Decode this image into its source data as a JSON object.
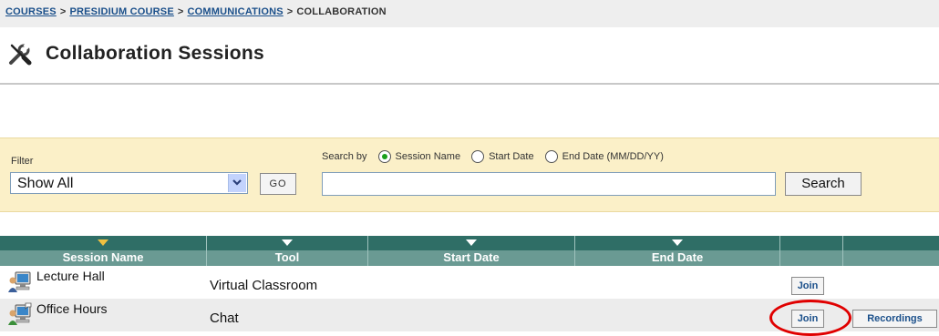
{
  "breadcrumb": {
    "items": [
      {
        "label": "COURSES",
        "link": true
      },
      {
        "label": "PRESIDIUM COURSE",
        "link": true
      },
      {
        "label": "COMMUNICATIONS",
        "link": true
      },
      {
        "label": "COLLABORATION",
        "link": false
      }
    ],
    "separator": ">"
  },
  "page": {
    "title": "Collaboration Sessions",
    "title_icon": "tools-icon"
  },
  "filter": {
    "label": "Filter",
    "selected": "Show All",
    "go_label": "GO"
  },
  "search": {
    "by_label": "Search by",
    "options": [
      {
        "label": "Session Name",
        "checked": true
      },
      {
        "label": "Start Date",
        "checked": false
      },
      {
        "label": "End Date (MM/DD/YY)",
        "checked": false
      }
    ],
    "value": "",
    "button_label": "Search"
  },
  "table": {
    "columns": [
      {
        "label": "Session Name",
        "sorted": true
      },
      {
        "label": "Tool",
        "sorted": false
      },
      {
        "label": "Start Date",
        "sorted": false
      },
      {
        "label": "End Date",
        "sorted": false
      },
      {
        "label": "",
        "sorted": false
      },
      {
        "label": "",
        "sorted": false
      }
    ],
    "rows": [
      {
        "name": "Lecture Hall",
        "tool": "Virtual Classroom",
        "join_label": "Join",
        "recordings_label": ""
      },
      {
        "name": "Office Hours",
        "tool": "Chat",
        "join_label": "Join",
        "recordings_label": "Recordings"
      }
    ]
  },
  "colors": {
    "header_dark": "#2f6e66",
    "header_light": "#6a9a93",
    "panel": "#fbf0c8",
    "highlight": "#e00000"
  }
}
